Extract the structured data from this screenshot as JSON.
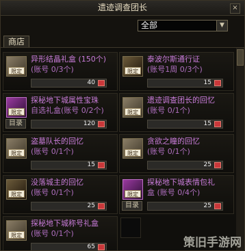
{
  "window": {
    "title": "遗迹调查团长",
    "close_label": "×"
  },
  "filter": {
    "selected": "全部",
    "arrow": "▼"
  },
  "tab": {
    "label": "商店"
  },
  "items": [
    {
      "name": "异形结晶礼盒 (150个)",
      "sub1": "(账号 0/3个)",
      "sub2": "",
      "price": "40",
      "limit_label": "限定",
      "catalog": ""
    },
    {
      "name": "泰波尔斯通行证",
      "sub1": "(账号1周 0/3个)",
      "sub2": "",
      "price": "15",
      "limit_label": "限定",
      "catalog": ""
    },
    {
      "name": "探秘地下城属性宝珠",
      "sub1": "自选礼盒(账号 0/2个)",
      "sub2": "",
      "price": "120",
      "limit_label": "限定",
      "catalog": "目录"
    },
    {
      "name": "遗迹调查团长的回忆",
      "sub1": "(账号 0/1个)",
      "sub2": "",
      "price": "15",
      "limit_label": "限定",
      "catalog": ""
    },
    {
      "name": "盗墓队长的回忆",
      "sub1": "(账号 0/1个)",
      "sub2": "",
      "price": "15",
      "limit_label": "限定",
      "catalog": ""
    },
    {
      "name": "贪欲之瞳的回忆",
      "sub1": "(账号 0/1个)",
      "sub2": "",
      "price": "25",
      "limit_label": "限定",
      "catalog": ""
    },
    {
      "name": "没落城主的回忆",
      "sub1": "(账号 0/1个)",
      "sub2": "",
      "price": "25",
      "limit_label": "限定",
      "catalog": ""
    },
    {
      "name": "探秘地下城表情包礼",
      "sub1": "盒 (账号 0/4个)",
      "sub2": "",
      "price": "25",
      "limit_label": "限定",
      "catalog": "目录"
    },
    {
      "name": "探秘地下城称号礼盒",
      "sub1": "(账号 0/1个)",
      "sub2": "",
      "price": "65",
      "limit_label": "限定",
      "catalog": ""
    }
  ],
  "watermark": {
    "text": "策旧手游网"
  }
}
